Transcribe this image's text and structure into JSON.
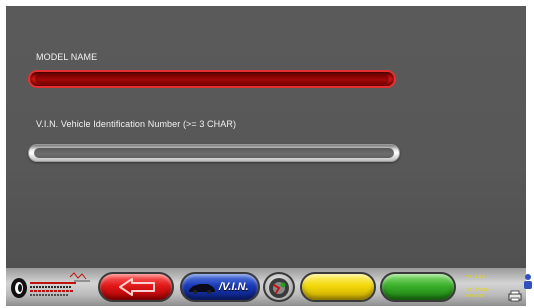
{
  "form": {
    "model_label": "MODEL NAME",
    "model_value": "",
    "vin_label": "V.I.N. Vehicle Identification Number (>= 3 CHAR)",
    "vin_value": ""
  },
  "toolbar": {
    "vin_button_label": "/V.I.N.",
    "version": "Ver. 1.8.5",
    "date": "10/10/2019",
    "time": "09:58:23"
  },
  "colors": {
    "screen_bg": "#585858",
    "model_field": "#c41010",
    "back_button": "#e01818",
    "vin_button": "#1a3ab8",
    "yellow_button": "#f2d80a",
    "green_button": "#3ab02a"
  },
  "icons": [
    "back-arrow-icon",
    "car-icon",
    "tire-icon",
    "brand-logo",
    "printer-icon",
    "person-icon"
  ]
}
